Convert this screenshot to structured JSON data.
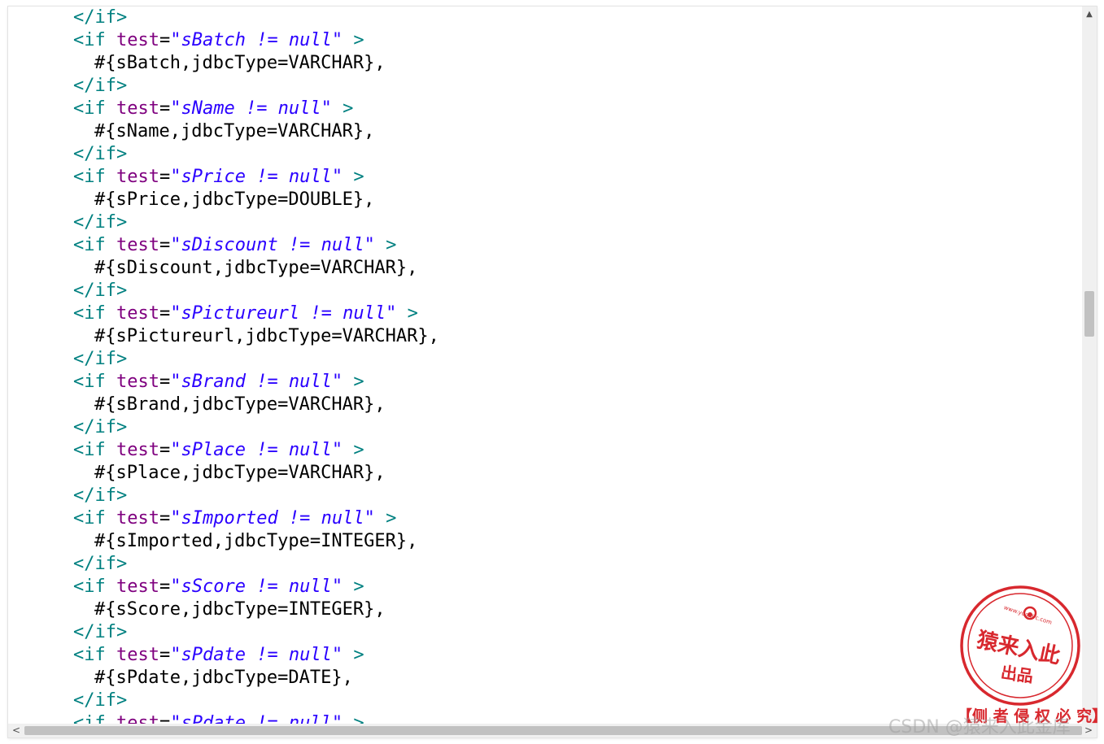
{
  "editor": {
    "lines": [
      {
        "kind": "close",
        "tag": "</if>"
      },
      {
        "kind": "open",
        "tag_open": "<if",
        "attr": "test",
        "eq": "=",
        "value": "\"sBatch != null\"",
        "tag_close": ">"
      },
      {
        "kind": "body",
        "text": "#{sBatch,jdbcType=VARCHAR},"
      },
      {
        "kind": "close",
        "tag": "</if>"
      },
      {
        "kind": "open",
        "tag_open": "<if",
        "attr": "test",
        "eq": "=",
        "value": "\"sName != null\"",
        "tag_close": ">"
      },
      {
        "kind": "body",
        "text": "#{sName,jdbcType=VARCHAR},"
      },
      {
        "kind": "close",
        "tag": "</if>"
      },
      {
        "kind": "open",
        "tag_open": "<if",
        "attr": "test",
        "eq": "=",
        "value": "\"sPrice != null\"",
        "tag_close": ">"
      },
      {
        "kind": "body",
        "text": "#{sPrice,jdbcType=DOUBLE},"
      },
      {
        "kind": "close",
        "tag": "</if>"
      },
      {
        "kind": "open",
        "tag_open": "<if",
        "attr": "test",
        "eq": "=",
        "value": "\"sDiscount != null\"",
        "tag_close": ">"
      },
      {
        "kind": "body",
        "text": "#{sDiscount,jdbcType=VARCHAR},"
      },
      {
        "kind": "close",
        "tag": "</if>"
      },
      {
        "kind": "open",
        "tag_open": "<if",
        "attr": "test",
        "eq": "=",
        "value": "\"sPictureurl != null\"",
        "tag_close": ">"
      },
      {
        "kind": "body",
        "text": "#{sPictureurl,jdbcType=VARCHAR},"
      },
      {
        "kind": "close",
        "tag": "</if>"
      },
      {
        "kind": "open",
        "tag_open": "<if",
        "attr": "test",
        "eq": "=",
        "value": "\"sBrand != null\"",
        "tag_close": ">"
      },
      {
        "kind": "body",
        "text": "#{sBrand,jdbcType=VARCHAR},"
      },
      {
        "kind": "close",
        "tag": "</if>"
      },
      {
        "kind": "open",
        "tag_open": "<if",
        "attr": "test",
        "eq": "=",
        "value": "\"sPlace != null\"",
        "tag_close": ">"
      },
      {
        "kind": "body",
        "text": "#{sPlace,jdbcType=VARCHAR},"
      },
      {
        "kind": "close",
        "tag": "</if>"
      },
      {
        "kind": "open",
        "tag_open": "<if",
        "attr": "test",
        "eq": "=",
        "value": "\"sImported != null\"",
        "tag_close": ">"
      },
      {
        "kind": "body",
        "text": "#{sImported,jdbcType=INTEGER},"
      },
      {
        "kind": "close",
        "tag": "</if>"
      },
      {
        "kind": "open",
        "tag_open": "<if",
        "attr": "test",
        "eq": "=",
        "value": "\"sScore != null\"",
        "tag_close": ">"
      },
      {
        "kind": "body",
        "text": "#{sScore,jdbcType=INTEGER},"
      },
      {
        "kind": "close",
        "tag": "</if>"
      },
      {
        "kind": "open",
        "tag_open": "<if",
        "attr": "test",
        "eq": "=",
        "value": "\"sPdate != null\"",
        "tag_close": ">"
      },
      {
        "kind": "body",
        "text": "#{sPdate,jdbcType=DATE},"
      },
      {
        "kind": "close",
        "tag": "</if>"
      },
      {
        "kind": "open",
        "tag_open": "<if",
        "attr": "test",
        "eq": "=",
        "value": "\"sPdate != null\"",
        "tag_close": ">"
      }
    ]
  },
  "scrollbars": {
    "vertical_up_arrow": "▲",
    "horizontal_left_arrow": "<",
    "horizontal_right_arrow": ">"
  },
  "stamp": {
    "url_text": "www.yuanlrc.com",
    "main_text": "猿来入此",
    "sub_text": "出品",
    "caption": "【侧 者 侵 权 必 究】",
    "color": "#d8282e"
  },
  "watermark": {
    "text": "CSDN @猿来入此金库"
  },
  "colors": {
    "tag": "#008080",
    "attribute": "#7f007f",
    "value": "#2a00ff",
    "text": "#000000"
  }
}
